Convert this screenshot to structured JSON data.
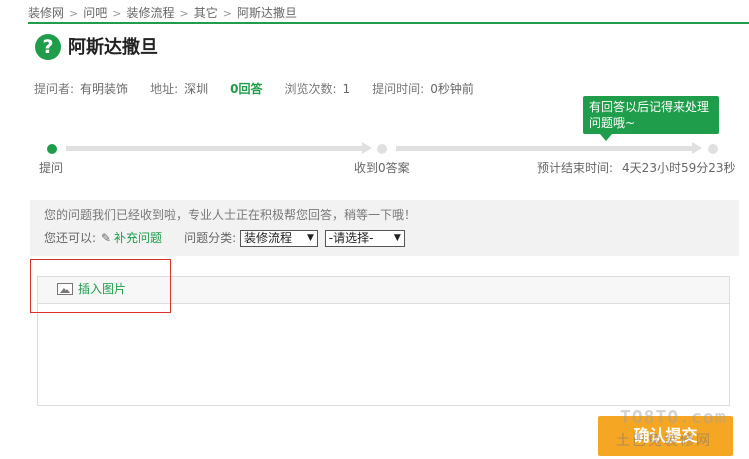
{
  "breadcrumb": [
    "装修网",
    "问吧",
    "装修流程",
    "其它",
    "阿斯达撒旦"
  ],
  "question": {
    "icon": "?",
    "title": "阿斯达撒旦"
  },
  "meta": {
    "asker_label": "提问者:",
    "asker": "有明装饰",
    "location_label": "地址:",
    "location": "深圳",
    "answers": "0回答",
    "views_label": "浏览次数:",
    "views": "1",
    "time_label": "提问时间:",
    "time": "0秒钟前"
  },
  "progress": {
    "steps": [
      "提问",
      "收到0答案"
    ],
    "end_label": "预计结束时间:",
    "end_time": "4天23小时59分23秒",
    "current_step": 1
  },
  "tooltip": {
    "text": "有回答以后记得来处理问题哦~"
  },
  "notice": {
    "text": "您的问题我们已经收到啦，专业人士正在积极帮您回答，稍等一下哦！",
    "more_label": "您还可以:",
    "supplement": "补充问题",
    "category_label": "问题分类:",
    "category_value": "装修流程",
    "subcategory_value": "-请选择-"
  },
  "editor": {
    "insert_image": "插入图片"
  },
  "submit": {
    "label": "确认提交"
  },
  "watermark": {
    "logo": "TO8TO.com",
    "text": "土巴兔装修网"
  },
  "colors": {
    "brand_green": "#1f9d4a",
    "submit_orange": "#f5a623",
    "highlight_red": "#d9342b"
  }
}
